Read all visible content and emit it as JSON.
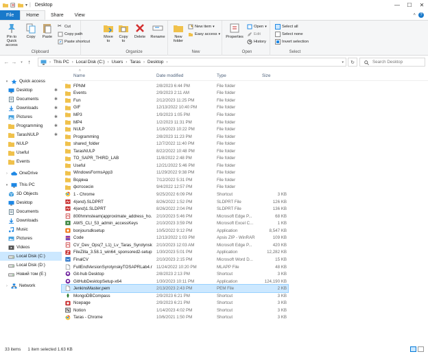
{
  "window": {
    "title": "Desktop",
    "controls": [
      "—",
      "☐",
      "✕"
    ]
  },
  "tabs": {
    "file": "File",
    "home": "Home",
    "share": "Share",
    "view": "View"
  },
  "ribbon": {
    "clipboard": {
      "label": "Clipboard",
      "pin": "Pin to Quick access",
      "copy": "Copy",
      "paste": "Paste",
      "cut": "Cut",
      "copy_path": "Copy path",
      "paste_shortcut": "Paste shortcut"
    },
    "organize": {
      "label": "Organize",
      "move_to": "Move to",
      "copy_to": "Copy to",
      "delete": "Delete",
      "rename": "Rename"
    },
    "new": {
      "label": "New",
      "new_folder": "New folder",
      "new_item": "New item",
      "easy_access": "Easy access"
    },
    "open": {
      "label": "Open",
      "properties": "Properties",
      "open": "Open",
      "edit": "Edit",
      "history": "History"
    },
    "select": {
      "label": "Select",
      "select_all": "Select all",
      "select_none": "Select none",
      "invert": "Invert selection"
    }
  },
  "address": {
    "crumbs": [
      "This PC",
      "Local Disk (C:)",
      "Users",
      "Taras",
      "Desktop"
    ],
    "search_placeholder": "Search Desktop"
  },
  "nav": [
    {
      "label": "Quick access",
      "icon": "star-icon",
      "color": "#1e88e5",
      "level": 0,
      "expanded": true
    },
    {
      "label": "Desktop",
      "icon": "desktop-icon",
      "color": "#1e88e5",
      "level": 1,
      "pinned": true,
      "selected": false
    },
    {
      "label": "Documents",
      "icon": "documents-icon",
      "color": "#607d8b",
      "level": 1,
      "pinned": true
    },
    {
      "label": "Downloads",
      "icon": "downloads-icon",
      "color": "#1e88e5",
      "level": 1,
      "pinned": true
    },
    {
      "label": "Pictures",
      "icon": "pictures-icon",
      "color": "#4aa3df",
      "level": 1,
      "pinned": true
    },
    {
      "label": "Programming",
      "icon": "folder-icon",
      "color": "#f0c14b",
      "level": 1,
      "pinned": true
    },
    {
      "label": "TarasNULP",
      "icon": "folder-icon",
      "color": "#f0c14b",
      "level": 1,
      "pinned": true
    },
    {
      "label": "NULP",
      "icon": "folder-icon",
      "color": "#f0c14b",
      "level": 1
    },
    {
      "label": "Useful",
      "icon": "folder-icon",
      "color": "#f0c14b",
      "level": 1
    },
    {
      "label": "Events",
      "icon": "folder-icon",
      "color": "#f0c14b",
      "level": 1
    },
    {
      "label": "OneDrive",
      "icon": "cloud-icon",
      "color": "#1e88e5",
      "level": 0,
      "gap": true
    },
    {
      "label": "This PC",
      "icon": "computer-icon",
      "color": "#1e88e5",
      "level": 0,
      "gap": true,
      "expanded": true
    },
    {
      "label": "3D Objects",
      "icon": "cube-icon",
      "color": "#4aa3df",
      "level": 1
    },
    {
      "label": "Desktop",
      "icon": "desktop-icon",
      "color": "#1e88e5",
      "level": 1
    },
    {
      "label": "Documents",
      "icon": "documents-icon",
      "color": "#607d8b",
      "level": 1
    },
    {
      "label": "Downloads",
      "icon": "downloads-icon",
      "color": "#1e88e5",
      "level": 1
    },
    {
      "label": "Music",
      "icon": "music-icon",
      "color": "#1e88e5",
      "level": 1
    },
    {
      "label": "Pictures",
      "icon": "pictures-icon",
      "color": "#4aa3df",
      "level": 1
    },
    {
      "label": "Videos",
      "icon": "videos-icon",
      "color": "#555555",
      "level": 1
    },
    {
      "label": "Local Disk (C:)",
      "icon": "drive-icon",
      "color": "#888888",
      "level": 1,
      "selected": true
    },
    {
      "label": "Local Disk (D:)",
      "icon": "drive-icon",
      "color": "#888888",
      "level": 1
    },
    {
      "label": "Новий том (E:)",
      "icon": "drive-icon",
      "color": "#888888",
      "level": 1
    },
    {
      "label": "Network",
      "icon": "network-icon",
      "color": "#1e88e5",
      "level": 0,
      "gap": true
    }
  ],
  "columns": {
    "name": "Name",
    "date": "Date modified",
    "type": "Type",
    "size": "Size"
  },
  "files": [
    {
      "name": "FPNM",
      "date": "2/8/2023 6:44 PM",
      "type": "File folder",
      "size": "",
      "icon": "folder-icon",
      "color": "#f0c14b"
    },
    {
      "name": "Events",
      "date": "2/9/2023 2:11 AM",
      "type": "File folder",
      "size": "",
      "icon": "folder-icon",
      "color": "#f0c14b"
    },
    {
      "name": "Fun",
      "date": "2/12/2023 11:25 PM",
      "type": "File folder",
      "size": "",
      "icon": "folder-icon",
      "color": "#f0c14b"
    },
    {
      "name": "GIF",
      "date": "12/13/2022 10:40 PM",
      "type": "File folder",
      "size": "",
      "icon": "folder-icon",
      "color": "#f0c14b"
    },
    {
      "name": "MP3",
      "date": "1/9/2023 1:05 PM",
      "type": "File folder",
      "size": "",
      "icon": "folder-icon",
      "color": "#f0c14b"
    },
    {
      "name": "MP4",
      "date": "1/2/2023 11:31 PM",
      "type": "File folder",
      "size": "",
      "icon": "folder-icon",
      "color": "#f0c14b"
    },
    {
      "name": "NULP",
      "date": "1/16/2023 10:22 PM",
      "type": "File folder",
      "size": "",
      "icon": "folder-icon",
      "color": "#f0c14b"
    },
    {
      "name": "Programming",
      "date": "2/8/2023 11:23 PM",
      "type": "File folder",
      "size": "",
      "icon": "folder-icon",
      "color": "#f0c14b"
    },
    {
      "name": "shared_folder",
      "date": "12/7/2022 11:40 PM",
      "type": "File folder",
      "size": "",
      "icon": "folder-icon",
      "color": "#f0c14b"
    },
    {
      "name": "TarasNULP",
      "date": "8/22/2022 10:48 PM",
      "type": "File folder",
      "size": "",
      "icon": "folder-icon",
      "color": "#f0c14b"
    },
    {
      "name": "TO_SAPR_THIRD_LAB",
      "date": "11/8/2022 2:48 PM",
      "type": "File folder",
      "size": "",
      "icon": "folder-icon",
      "color": "#f0c14b"
    },
    {
      "name": "Useful",
      "date": "12/21/2022 5:46 PM",
      "type": "File folder",
      "size": "",
      "icon": "folder-icon",
      "color": "#f0c14b"
    },
    {
      "name": "WindowsFormsApp3",
      "date": "11/29/2022 9:38 PM",
      "type": "File folder",
      "size": "",
      "icon": "folder-icon",
      "color": "#f0c14b"
    },
    {
      "name": "Водяна",
      "date": "7/12/2022 5:31 PM",
      "type": "File folder",
      "size": "",
      "icon": "folder-icon",
      "color": "#f0c14b"
    },
    {
      "name": "фотосесія",
      "date": "9/4/2022 12:57 PM",
      "type": "File folder",
      "size": "",
      "icon": "folder-icon",
      "color": "#f0c14b"
    },
    {
      "name": "1 - Chrome",
      "date": "9/25/2022 6:09 PM",
      "type": "Shortcut",
      "size": "3 KB",
      "icon": "chrome-icon",
      "color": "#e53935"
    },
    {
      "name": "4(end).SLDPRT",
      "date": "8/26/2022 1:52 PM",
      "type": "SLDPRT File",
      "size": "126 KB",
      "icon": "solidworks-icon",
      "color": "#c62828"
    },
    {
      "name": "4(end)1.SLDPRT",
      "date": "8/26/2022 2:04 PM",
      "type": "SLDPRT File",
      "size": "136 KB",
      "icon": "solidworks-icon",
      "color": "#c62828"
    },
    {
      "name": "800hmmsteam(approximate_address_ho...",
      "date": "2/10/2023 5:46 PM",
      "type": "Microsoft Edge P...",
      "size": "68 KB",
      "icon": "pdf-icon",
      "color": "#c62828"
    },
    {
      "name": "AWS_CLI_53_admin_accessKeys",
      "date": "2/10/2023 3:59 PM",
      "type": "Microsoft Excel C...",
      "size": "1 KB",
      "icon": "excel-icon",
      "color": "#2e7d32"
    },
    {
      "name": "bonjoursdksetup",
      "date": "10/5/2022 9:12 PM",
      "type": "Application",
      "size": "8,547 KB",
      "icon": "app-icon",
      "color": "#ef6c00"
    },
    {
      "name": "Code",
      "date": "12/13/2022 1:03 PM",
      "type": "Apsis ZIP - WinRAR",
      "size": "109 KB",
      "icon": "archive-icon",
      "color": "#8e24aa"
    },
    {
      "name": "CV_Dev_Ops(7_L1)_Lv_Taras_Syrotynskyi",
      "date": "2/10/2023 12:03 AM",
      "type": "Microsoft Edge P...",
      "size": "420 KB",
      "icon": "pdf-icon",
      "color": "#c62828"
    },
    {
      "name": "FileZilla_3.58.1_win64_sponsored2-setup",
      "date": "1/30/2023 5:01 PM",
      "type": "Application",
      "size": "12,282 KB",
      "icon": "filezilla-icon",
      "color": "#c62828"
    },
    {
      "name": "FinalCV",
      "date": "2/10/2023 2:15 PM",
      "type": "Microsoft Word D...",
      "size": "15 KB",
      "icon": "word-icon",
      "color": "#1565c0"
    },
    {
      "name": "FullEndVersionSyrotynskyTOSAPRLab4.m...",
      "date": "11/24/2022 10:20 PM",
      "type": "MLAPP File",
      "size": "48 KB",
      "icon": "file-icon",
      "color": "#9e9e9e"
    },
    {
      "name": "Git-hub Desktop",
      "date": "2/8/2023 2:13 PM",
      "type": "Shortcut",
      "size": "3 KB",
      "icon": "github-icon",
      "color": "#6a1b9a"
    },
    {
      "name": "GitHubDesktopSetup-x64",
      "date": "1/30/2023 10:11 PM",
      "type": "Application",
      "size": "124,190 KB",
      "icon": "github-icon",
      "color": "#6a1b9a"
    },
    {
      "name": "JenkinsMaster.pem",
      "date": "2/13/2023 2:43 PM",
      "type": "PEM File",
      "size": "2 KB",
      "icon": "file-icon",
      "color": "#9e9e9e",
      "selected": true
    },
    {
      "name": "MongoDBCompass",
      "date": "2/9/2023 6:21 PM",
      "type": "Shortcut",
      "size": "3 KB",
      "icon": "mongodb-icon",
      "color": "#2e7d32"
    },
    {
      "name": "Ncepage",
      "date": "2/9/2023 6:21 PM",
      "type": "Shortcut",
      "size": "3 KB",
      "icon": "app-icon",
      "color": "#c62828"
    },
    {
      "name": "Notion",
      "date": "1/14/2023 4:02 PM",
      "type": "Shortcut",
      "size": "3 KB",
      "icon": "notion-icon",
      "color": "#333333"
    },
    {
      "name": "Taras - Chrome",
      "date": "10/6/2021 1:50 PM",
      "type": "Shortcut",
      "size": "3 KB",
      "icon": "chrome-icon",
      "color": "#e53935"
    }
  ],
  "status": {
    "count": "33 items",
    "selected": "1 item selected  1.63 KB"
  }
}
